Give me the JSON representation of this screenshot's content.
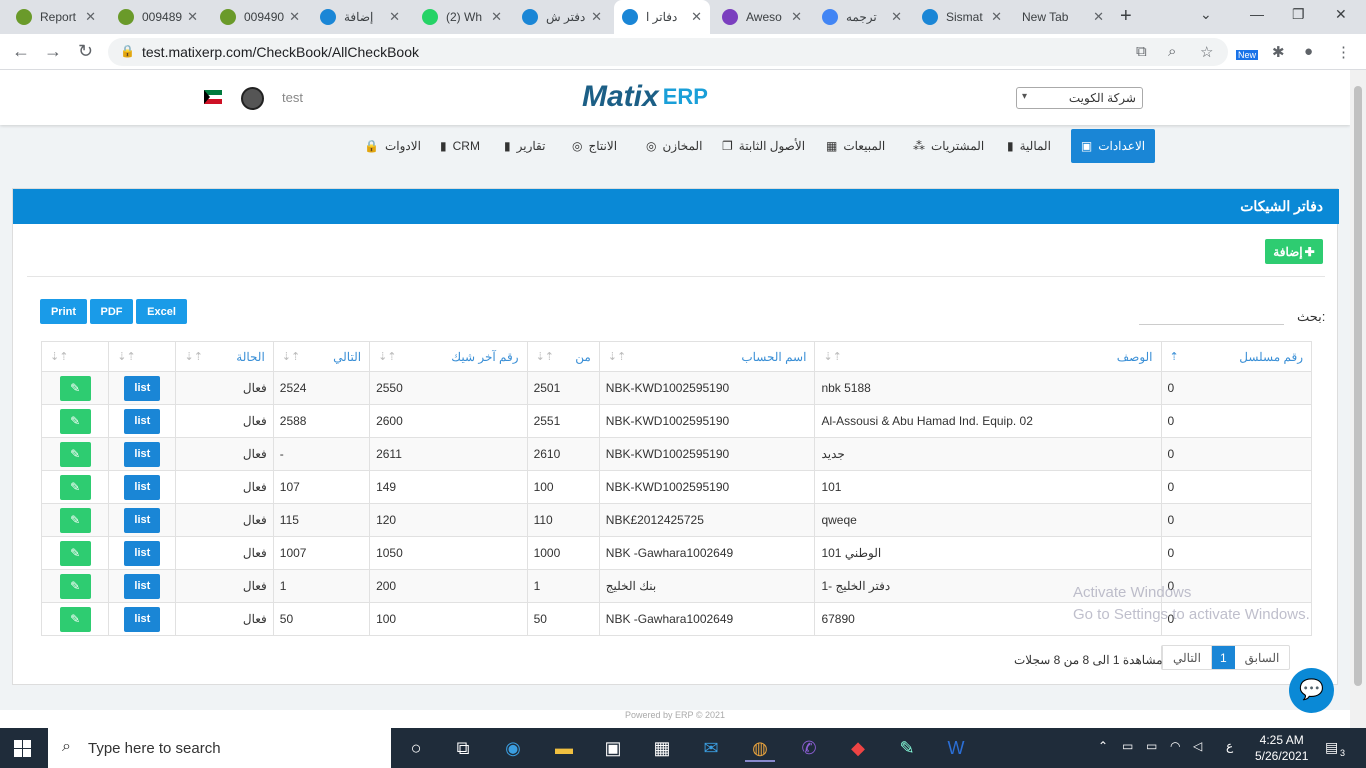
{
  "browser": {
    "tabs": [
      {
        "title": "Report",
        "color": "#6a9a2a"
      },
      {
        "title": "009489",
        "color": "#6a9a2a"
      },
      {
        "title": "009490",
        "color": "#6a9a2a"
      },
      {
        "title": "إضافة",
        "color": "#1a86d6"
      },
      {
        "title": "(2) Wh",
        "color": "#25d366"
      },
      {
        "title": "دفتر ش",
        "color": "#1a86d6"
      },
      {
        "title": "دفاتر ا",
        "color": "#1a86d6",
        "active": true
      },
      {
        "title": "Aweso",
        "color": "#7b3fbf"
      },
      {
        "title": "ترجمه",
        "color": "#4285f4"
      },
      {
        "title": "Sismat",
        "color": "#1a86d6"
      },
      {
        "title": "New Tab",
        "color": ""
      }
    ],
    "url": "test.matixerp.com/CheckBook/AllCheckBook",
    "new_badge": "New"
  },
  "header": {
    "user": "test",
    "logo_m": "Matix",
    "logo_erp": "ERP",
    "company": "شركة الكويت"
  },
  "menu": [
    {
      "label": "الاعدادات",
      "icon": "▣",
      "active": true
    },
    {
      "label": "المالية",
      "icon": "▮"
    },
    {
      "label": "المشتريات",
      "icon": "⁂"
    },
    {
      "label": "المبيعات",
      "icon": "▦"
    },
    {
      "label": "الأصول الثابتة",
      "icon": "❐"
    },
    {
      "label": "المخازن",
      "icon": "◎"
    },
    {
      "label": "الانتاج",
      "icon": "◎"
    },
    {
      "label": "تقارير",
      "icon": "▮"
    },
    {
      "label": "CRM",
      "icon": "▮"
    },
    {
      "label": "الادوات",
      "icon": "🔒"
    }
  ],
  "panel": {
    "title": "دفاتر الشيكات",
    "add_label": "إضافة",
    "search_label": "بحث:",
    "export": [
      "Print",
      "PDF",
      "Excel"
    ]
  },
  "table": {
    "columns": [
      "رقم مسلسل",
      "الوصف",
      "اسم الحساب",
      "من",
      "رقم آخر شيك",
      "التالي",
      "الحالة",
      "",
      ""
    ],
    "rows": [
      [
        "0",
        "nbk 5188",
        "NBK-KWD1002595190",
        "2501",
        "2550",
        "2524",
        "فعال"
      ],
      [
        "0",
        "Al-Assousi & Abu Hamad Ind. Equip. 02",
        "NBK-KWD1002595190",
        "2551",
        "2600",
        "2588",
        "فعال"
      ],
      [
        "0",
        "جديد",
        "NBK-KWD1002595190",
        "2610",
        "2611",
        "-",
        "فعال"
      ],
      [
        "0",
        "101",
        "NBK-KWD1002595190",
        "100",
        "149",
        "107",
        "فعال"
      ],
      [
        "0",
        "qweqe",
        "NBK£2012425725",
        "110",
        "120",
        "115",
        "فعال"
      ],
      [
        "0",
        "الوطني 101",
        "NBK -Gawhara1002649",
        "1000",
        "1050",
        "1007",
        "فعال"
      ],
      [
        "0",
        "دفتر الخليج -1",
        "بنك الخليج",
        "1",
        "200",
        "1",
        "فعال"
      ],
      [
        "0",
        "67890",
        "NBK -Gawhara1002649",
        "50",
        "100",
        "50",
        "فعال"
      ]
    ],
    "list_label": "list",
    "edit_icon": "pencil-icon"
  },
  "pagination": {
    "prev": "السابق",
    "current": "1",
    "next": "التالي",
    "info": "مشاهدة 1 الى 8 من 8 سجلات"
  },
  "watermark": {
    "line1": "Activate Windows",
    "line2": "Go to Settings to activate Windows."
  },
  "footer": "Powered by ERP © 2021",
  "taskbar": {
    "search_placeholder": "Type here to search",
    "time": "4:25 AM",
    "date": "5/26/2021",
    "lang": "ع",
    "notif_count": "3"
  }
}
